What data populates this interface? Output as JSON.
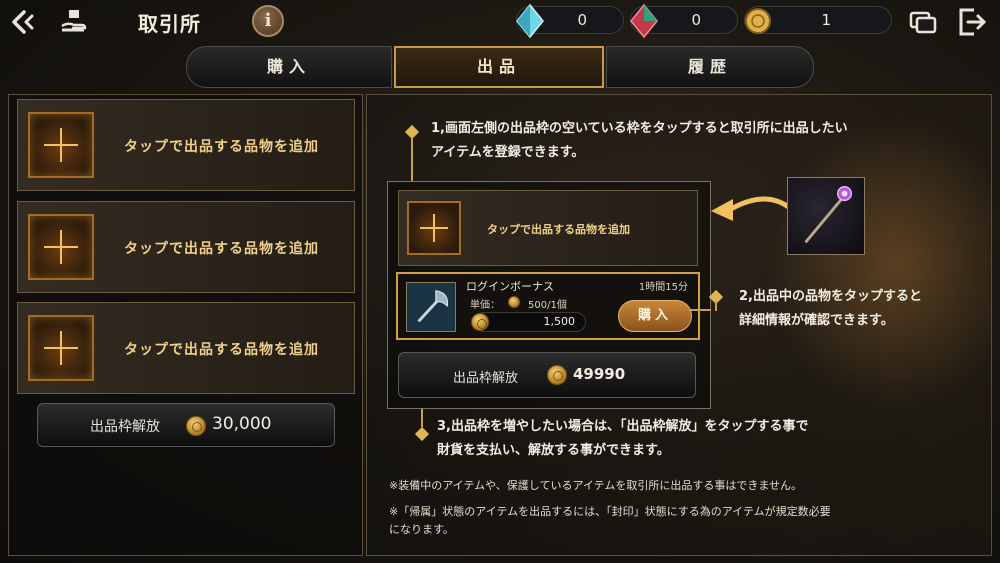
{
  "header": {
    "title": "取引所",
    "info_label": "i",
    "currencies": [
      {
        "name": "blue-crystal",
        "value": "0"
      },
      {
        "name": "red-crystal",
        "value": "0"
      },
      {
        "name": "gold-coin",
        "value": "1"
      }
    ]
  },
  "tabs": [
    "購入",
    "出品",
    "履歴"
  ],
  "active_tab": "出品",
  "left": {
    "slots": [
      {
        "label": "タップで出品する品物を追加"
      },
      {
        "label": "タップで出品する品物を追加"
      },
      {
        "label": "タップで出品する品物を追加"
      }
    ],
    "unlock": {
      "label": "出品枠解放",
      "cost": "30,000"
    }
  },
  "right": {
    "step1": [
      "1,画面左側の出品枠の空いている枠をタップすると取引所に出品したい",
      "アイテムを登録できます。"
    ],
    "demo_slot_label": "タップで出品する品物を追加",
    "listing": {
      "name": "ログインボーナス",
      "time": "1時間15分",
      "unit_label": "単価：",
      "unit_value": "500/1個",
      "price": "1,500",
      "buy_label": "購入"
    },
    "demo_unlock": {
      "label": "出品枠解放",
      "cost": "49990"
    },
    "step2": [
      "2,出品中の品物をタップすると",
      "詳細情報が確認できます。"
    ],
    "step3": [
      "3,出品枠を増やしたい場合は、「出品枠解放」をタップする事で",
      "財貨を支払い、解放する事ができます。"
    ],
    "note1": "※装備中のアイテムや、保護しているアイテムを取引所に出品する事はできません。",
    "note2": [
      "※「帰属」状態のアイテムを出品するには、「封印」状態にする為のアイテムが規定数必要",
      "になります。"
    ]
  },
  "colors": {
    "accent_gold": "#c9a052",
    "tab_active_border": "#c89a45",
    "buy_button": "#b3722e"
  }
}
